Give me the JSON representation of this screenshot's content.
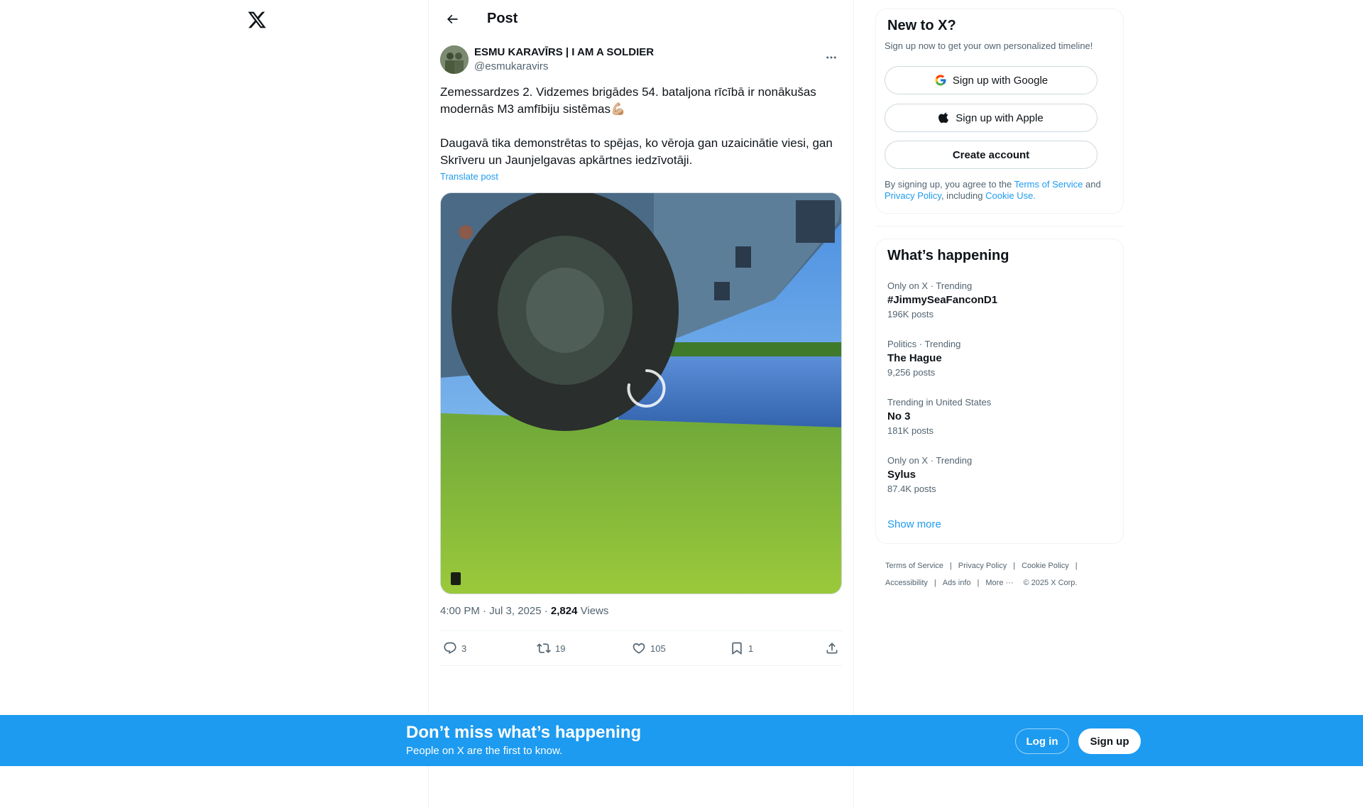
{
  "nav": {
    "logo_icon": "x-logo-icon"
  },
  "header": {
    "title": "Post",
    "back_icon": "arrow-left-icon"
  },
  "post": {
    "author_name": "ESMU KARAVĪRS | I AM A SOLDIER",
    "author_handle": "@esmukaravirs",
    "text_line_1": "Zemessardzes 2. Vidzemes brigādes 54. bataljona rīcībā ir nonākušas modernās M3 amfībiju sistēmas💪🏼",
    "text_line_2": "Daugavā tika demonstrētas to spējas, ko vēroja gan uzaicinātie viesi, gan Skrīveru un Jaunjelgavas apkārtnes iedzīvotāji.",
    "translate_label": "Translate post",
    "time": "4:00 PM · Jul 3, 2025 · ",
    "views_count": "2,824",
    "views_label": " Views",
    "replies": "3",
    "reposts": "19",
    "likes": "105",
    "bookmarks": "1"
  },
  "signup_card": {
    "title": "New to X?",
    "subtitle": "Sign up now to get your own personalized timeline!",
    "google_label": "Sign up with Google",
    "apple_label": "Sign up with Apple",
    "create_label": "Create account",
    "legal_prefix": "By signing up, you agree to the ",
    "terms_link": "Terms of Service",
    "legal_and": " and ",
    "privacy_link": "Privacy Policy",
    "legal_including": ", including ",
    "cookie_link": "Cookie Use."
  },
  "happening": {
    "title": "What’s happening",
    "trends": [
      {
        "meta": "Only on X · Trending",
        "name": "#JimmySeaFanconD1",
        "count": "196K posts"
      },
      {
        "meta": "Politics · Trending",
        "name": "The Hague",
        "count": "9,256 posts"
      },
      {
        "meta": "Trending in United States",
        "name": "No 3",
        "count": "181K posts"
      },
      {
        "meta": "Only on X · Trending",
        "name": "Sylus",
        "count": "87.4K posts"
      }
    ],
    "show_more": "Show more"
  },
  "footer": {
    "terms": "Terms of Service",
    "privacy": "Privacy Policy",
    "cookie": "Cookie Policy",
    "accessibility": "Accessibility",
    "ads": "Ads info",
    "more": "More ···",
    "copyright": "© 2025 X Corp."
  },
  "banner": {
    "title": "Don’t miss what’s happening",
    "subtitle": "People on X are the first to know.",
    "login": "Log in",
    "signup": "Sign up"
  },
  "colors": {
    "accent": "#1d9bf0",
    "text": "#0f1419",
    "muted": "#536471"
  }
}
